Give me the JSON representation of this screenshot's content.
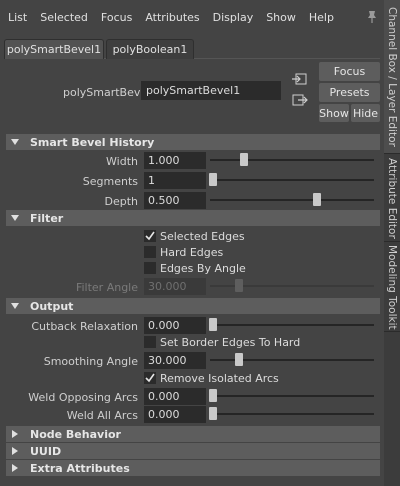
{
  "menubar": {
    "items": [
      "List",
      "Selected",
      "Focus",
      "Attributes",
      "Display",
      "Show",
      "Help"
    ]
  },
  "side_tabs": [
    "Channel Box / Layer Editor",
    "Attribute Editor",
    "Modeling Toolkit"
  ],
  "node_tabs": [
    "polySmartBevel1",
    "polyBoolean1"
  ],
  "header": {
    "label": "polySmartBevel:",
    "value": "polySmartBevel1"
  },
  "buttons": {
    "focus": "Focus",
    "presets": "Presets",
    "show": "Show",
    "hide": "Hide"
  },
  "sections": {
    "history": {
      "title": "Smart Bevel History",
      "rows": [
        {
          "label": "Width",
          "value": "1.000",
          "slider": 0.2
        },
        {
          "label": "Segments",
          "value": "1",
          "slider": 0.0
        },
        {
          "label": "Depth",
          "value": "0.500",
          "slider": 0.66
        }
      ]
    },
    "filter": {
      "title": "Filter",
      "checks": [
        {
          "label": "Selected Edges",
          "checked": true
        },
        {
          "label": "Hard Edges",
          "checked": false
        },
        {
          "label": "Edges By Angle",
          "checked": false
        }
      ],
      "angle": {
        "label": "Filter Angle",
        "value": "30.000",
        "slider": 0.17
      }
    },
    "output": {
      "title": "Output",
      "cutback": {
        "label": "Cutback Relaxation",
        "value": "0.000",
        "slider": 0.0
      },
      "border": {
        "label": "Set Border Edges To Hard",
        "checked": false
      },
      "smoothing": {
        "label": "Smoothing Angle",
        "value": "30.000",
        "slider": 0.17
      },
      "isolated": {
        "label": "Remove Isolated Arcs",
        "checked": true
      },
      "weld_opposing": {
        "label": "Weld Opposing Arcs",
        "value": "0.000",
        "slider": 0.0
      },
      "weld_all": {
        "label": "Weld All Arcs",
        "value": "0.000",
        "slider": 0.0
      }
    },
    "node_behavior": {
      "title": "Node Behavior"
    },
    "uuid": {
      "title": "UUID"
    },
    "extra": {
      "title": "Extra Attributes"
    }
  }
}
